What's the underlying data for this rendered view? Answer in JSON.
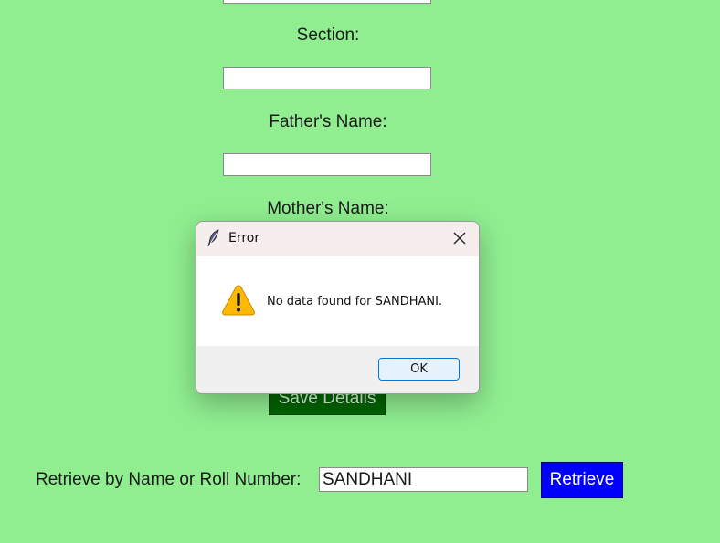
{
  "form": {
    "section_label": "Section:",
    "father_label": "Father's Name:",
    "mother_label": "Mother's Name:",
    "section_value": "",
    "father_value": "",
    "save_button": "Save Details"
  },
  "retrieve": {
    "label": "Retrieve by Name or Roll Number:",
    "input_value": "SANDHANI",
    "button_label": "Retrieve"
  },
  "dialog": {
    "title": "Error",
    "message": "No data found for SANDHANI.",
    "ok_label": "OK",
    "icon": "warning-icon",
    "title_icon": "feather-icon",
    "close_icon": "close-icon"
  },
  "colors": {
    "background": "#90ee90",
    "save_button": "#006400",
    "retrieve_button": "#0000ff",
    "warning": "#ffb900"
  }
}
